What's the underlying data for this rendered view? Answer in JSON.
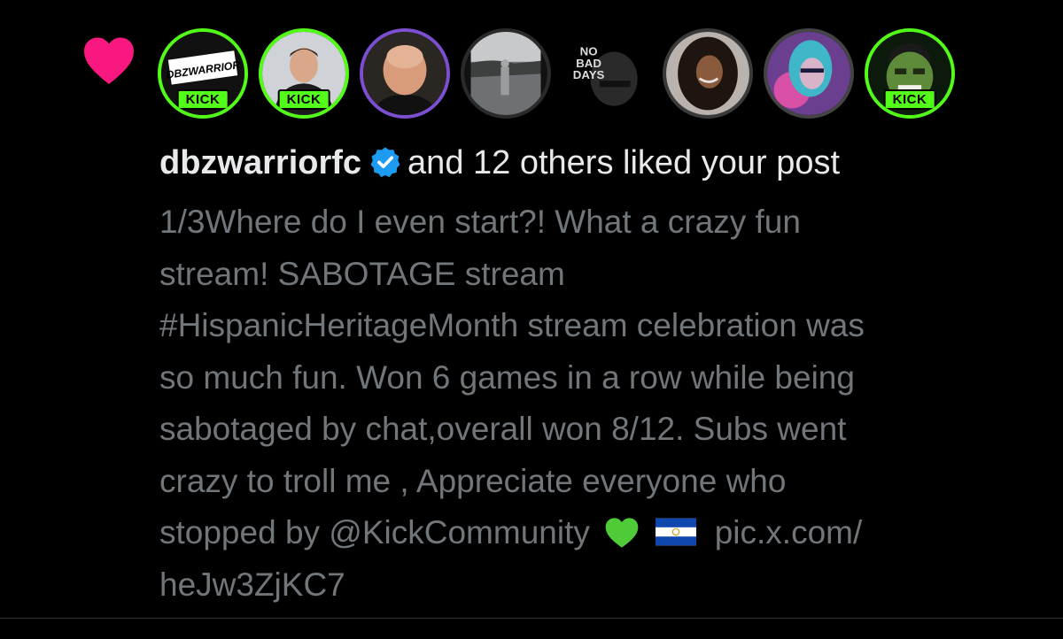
{
  "notification": {
    "type": "like",
    "username": "dbzwarriorfc",
    "verified": true,
    "action_text": "and 12 others liked your post",
    "avatars": [
      {
        "name": "dbzwarrior",
        "badge": "KICK",
        "logo_text": "DBZWARRIOR"
      },
      {
        "name": "user-2",
        "badge": "KICK"
      },
      {
        "name": "user-3"
      },
      {
        "name": "user-4"
      },
      {
        "name": "no-bad-days",
        "logo_text": "NO BAD DAYS"
      },
      {
        "name": "user-6"
      },
      {
        "name": "user-7"
      },
      {
        "name": "hulk",
        "badge": "KICK"
      }
    ],
    "post_lines": [
      "1/3Where do I even start?! What a crazy fun",
      "stream! SABOTAGE stream",
      "#HispanicHeritageMonth stream celebration was",
      "so much fun. Won 6 games in a row while being",
      "sabotaged by chat,overall won 8/12. Subs went",
      "crazy to troll me , Appreciate everyone who",
      "stopped by @KickCommunity",
      "pic.x.com/",
      "heJw3ZjKC7"
    ],
    "emojis": [
      "green-heart",
      "el-salvador-flag"
    ]
  },
  "colors": {
    "background": "#000000",
    "heart": "#f91880",
    "kick_green": "#53fc18",
    "verified_blue": "#1d9bf0",
    "primary_text": "#e7e9ea",
    "secondary_text": "#71767b"
  }
}
